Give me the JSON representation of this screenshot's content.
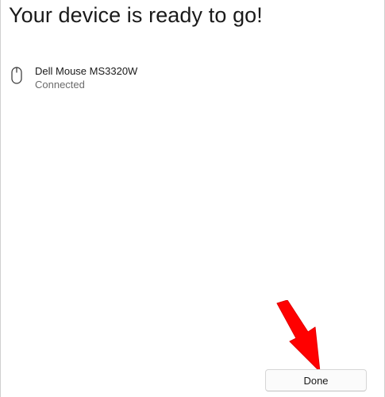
{
  "dialog": {
    "title": "Your device is ready to go!"
  },
  "device": {
    "icon": "mouse-icon",
    "name": "Dell Mouse MS3320W",
    "status": "Connected"
  },
  "actions": {
    "done_label": "Done"
  },
  "annotation": {
    "arrow_color": "#ff0000",
    "arrow_target": "done-button"
  }
}
